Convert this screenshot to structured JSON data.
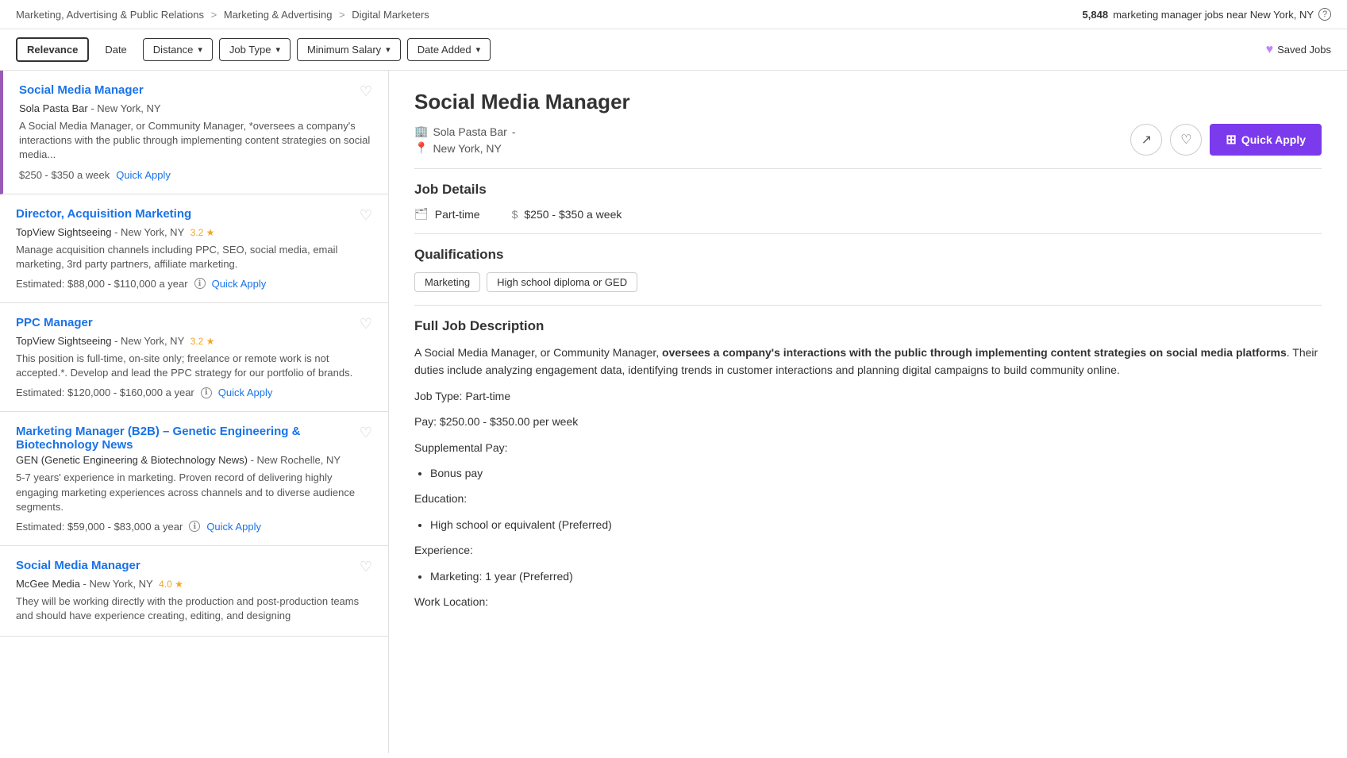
{
  "breadcrumb": {
    "items": [
      {
        "label": "Marketing, Advertising & Public Relations",
        "href": "#"
      },
      {
        "label": "Marketing & Advertising",
        "href": "#"
      },
      {
        "label": "Digital Marketers",
        "href": "#"
      }
    ]
  },
  "job_count": {
    "count": "5,848",
    "description": "marketing manager jobs near New York, NY"
  },
  "filters": {
    "relevance": "Relevance",
    "date": "Date",
    "distance": "Distance",
    "job_type": "Job Type",
    "minimum_salary": "Minimum Salary",
    "date_added": "Date Added",
    "saved_jobs": "Saved Jobs"
  },
  "job_list": [
    {
      "id": "job1",
      "title": "Social Media Manager",
      "company": "Sola Pasta Bar",
      "location": "New York, NY",
      "rating": null,
      "snippet": "A Social Media Manager, or Community Manager, *oversees a company's interactions with the public through implementing content strategies on social media...",
      "pay": "$250 - $350 a week",
      "quick_apply": true,
      "estimated": false
    },
    {
      "id": "job2",
      "title": "Director, Acquisition Marketing",
      "company": "TopView Sightseeing",
      "location": "New York, NY",
      "rating": "3.2",
      "snippet": "Manage acquisition channels including PPC, SEO, social media, email marketing, 3rd party partners, affiliate marketing.",
      "pay": "Estimated: $88,000 - $110,000 a year",
      "quick_apply": true,
      "estimated": true
    },
    {
      "id": "job3",
      "title": "PPC Manager",
      "company": "TopView Sightseeing",
      "location": "New York, NY",
      "rating": "3.2",
      "snippet": "This position is full-time, on-site only; freelance or remote work is not accepted.*. Develop and lead the PPC strategy for our portfolio of brands.",
      "pay": "Estimated: $120,000 - $160,000 a year",
      "quick_apply": true,
      "estimated": true
    },
    {
      "id": "job4",
      "title": "Marketing Manager (B2B) – Genetic Engineering & Biotechnology News",
      "company": "GEN (Genetic Engineering & Biotechnology News)",
      "location": "New Rochelle, NY",
      "rating": null,
      "snippet": "5-7 years' experience in marketing. Proven record of delivering highly engaging marketing experiences across channels and to diverse audience segments.",
      "pay": "Estimated: $59,000 - $83,000 a year",
      "quick_apply": true,
      "estimated": true
    },
    {
      "id": "job5",
      "title": "Social Media Manager",
      "company": "McGee Media",
      "location": "New York, NY",
      "rating": "4.0",
      "snippet": "They will be working directly with the production and post-production teams and should have experience creating, editing, and designing",
      "pay": null,
      "quick_apply": false,
      "estimated": false
    }
  ],
  "detail": {
    "title": "Social Media Manager",
    "company": "Sola Pasta Bar",
    "company_suffix": "-",
    "location": "New York, NY",
    "quick_apply_label": "Quick Apply",
    "job_details_section": "Job Details",
    "job_type": "Part-time",
    "pay": "$250 - $350 a week",
    "qualifications_section": "Qualifications",
    "qual_tags": [
      "Marketing",
      "High school diploma or GED"
    ],
    "full_desc_title": "Full Job Description",
    "desc_intro": "A Social Media Manager, or Community Manager,",
    "desc_bold": "oversees a company's interactions with the public through implementing content strategies on social media platforms",
    "desc_after_bold": ". Their duties include analyzing engagement data, identifying trends in customer interactions and planning digital campaigns to build community online.",
    "desc_job_type": "Job Type: Part-time",
    "desc_pay": "Pay: $250.00 - $350.00 per week",
    "desc_supplemental": "Supplemental Pay:",
    "desc_bonus": "Bonus pay",
    "desc_education": "Education:",
    "desc_edu_item": "High school or equivalent (Preferred)",
    "desc_experience": "Experience:",
    "desc_exp_item": "Marketing: 1 year (Preferred)",
    "desc_work_location": "Work Location:"
  }
}
